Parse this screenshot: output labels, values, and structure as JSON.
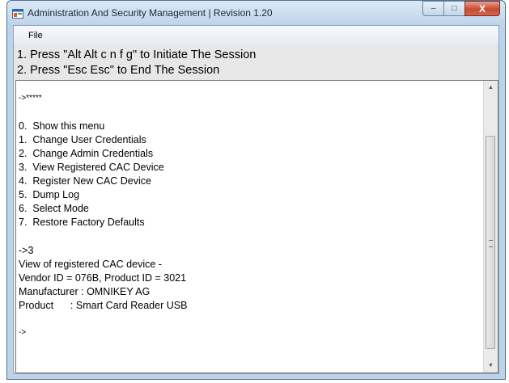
{
  "window": {
    "title": "Administration And Security Management  |  Revision 1.20",
    "icon": "app-window-icon"
  },
  "caption": {
    "minimize": "–",
    "maximize": "□",
    "close": "X"
  },
  "menu": {
    "file": "File"
  },
  "instructions": [
    "1. Press \"Alt Alt c n f g\" to Initiate The Session",
    "2. Press \"Esc Esc\" to End The Session"
  ],
  "console": {
    "lines": [
      "->*****",
      "",
      "0.  Show this menu",
      "1.  Change User Credentials",
      "2.  Change Admin Credentials",
      "3.  View Registered CAC Device",
      "4.  Register New CAC Device",
      "5.  Dump Log",
      "6.  Select Mode",
      "7.  Restore Factory Defaults",
      "",
      "->3",
      "View of registered CAC device -",
      "Vendor ID = 076B, Product ID = 3021",
      "Manufacturer : OMNIKEY AG",
      "Product      : Smart Card Reader USB",
      "",
      "->"
    ]
  },
  "scrollbar": {
    "up_arrow": "▲",
    "down_arrow": "▼"
  }
}
